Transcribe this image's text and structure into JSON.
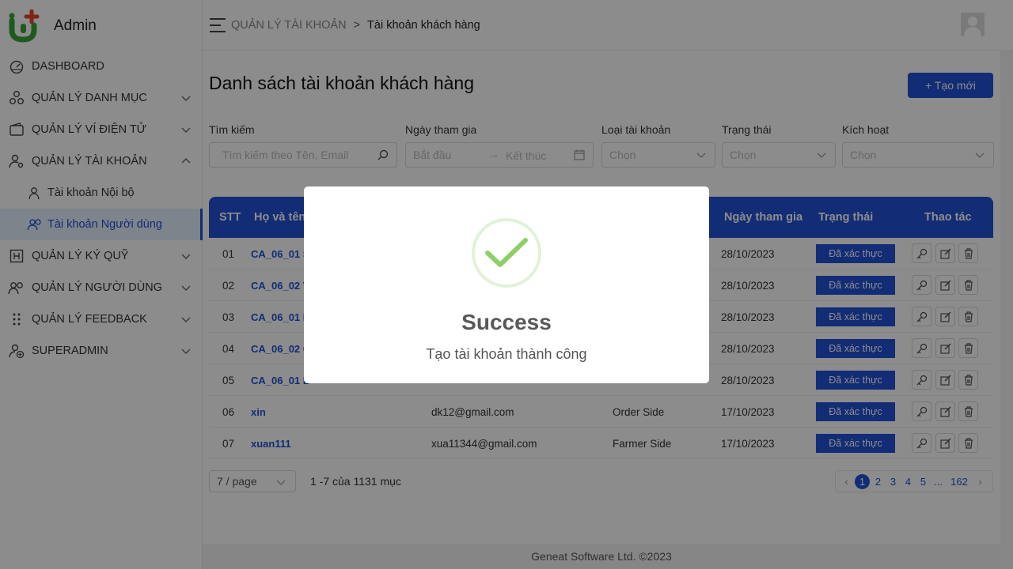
{
  "app": {
    "brand": "Admin"
  },
  "sidebar": {
    "items": [
      {
        "label": "DASHBOARD",
        "icon": "dashboard-icon"
      },
      {
        "label": "QUẢN LÝ DANH MỤC",
        "icon": "category-icon"
      },
      {
        "label": "QUẢN LÝ VÍ ĐIỆN TỬ",
        "icon": "wallet-icon"
      },
      {
        "label": "QUẢN LÝ TÀI KHOẢN",
        "icon": "user-settings-icon"
      },
      {
        "label": "Tài khoản Nội bộ",
        "icon": "user-icon"
      },
      {
        "label": "Tài khoản Người dùng",
        "icon": "users-icon"
      },
      {
        "label": "QUẢN LÝ KÝ QUỸ",
        "icon": "deposit-icon"
      },
      {
        "label": "QUẢN LÝ NGƯỜI DÙNG",
        "icon": "users-icon"
      },
      {
        "label": "QUẢN LÝ FEEDBACK",
        "icon": "drag-dots-icon"
      },
      {
        "label": "SUPERADMIN",
        "icon": "user-add-icon"
      }
    ]
  },
  "header": {
    "breadcrumb_parent": "QUẢN LÝ TÀI KHOẢN",
    "breadcrumb_current": "Tài khoản khách hàng"
  },
  "page": {
    "title": "Danh sách tài khoản khách hàng",
    "create_label": "+ Tạo mới"
  },
  "filters": {
    "search_label": "Tìm kiếm",
    "search_placeholder": "Tìm kiếm theo Tên, Email",
    "date_label": "Ngày tham gia",
    "date_start": "Bắt đầu",
    "date_end": "Kết thúc",
    "type_label": "Loại tài khoản",
    "type_value": "Chọn",
    "status_label": "Trạng thái",
    "status_value": "Chọn",
    "active_label": "Kích hoạt",
    "active_value": "Chọn"
  },
  "table": {
    "columns": {
      "stt": "STT",
      "name": "Họ và tên",
      "joined": "Ngày tham gia",
      "status": "Trạng thái",
      "actions": "Thao tác"
    },
    "rows": [
      {
        "stt": "01",
        "name": "CA_06_01 S",
        "email": "",
        "type": "",
        "joined": "28/10/2023",
        "status": "Đã xác thực"
      },
      {
        "stt": "02",
        "name": "CA_06_02 V",
        "email": "",
        "type": "",
        "joined": "28/10/2023",
        "status": "Đã xác thực"
      },
      {
        "stt": "03",
        "name": "CA_06_01 E",
        "email": "",
        "type": "",
        "joined": "28/10/2023",
        "status": "Đã xác thực"
      },
      {
        "stt": "04",
        "name": "CA_06_02 C",
        "email": "",
        "type": "",
        "joined": "28/10/2023",
        "status": "Đã xác thực"
      },
      {
        "stt": "05",
        "name": "CA_06_01 B",
        "email": "",
        "type": "",
        "joined": "28/10/2023",
        "status": "Đã xác thực"
      },
      {
        "stt": "06",
        "name": "xin",
        "email": "dk12@gmail.com",
        "type": "Order Side",
        "joined": "17/10/2023",
        "status": "Đã xác thực"
      },
      {
        "stt": "07",
        "name": "xuan111",
        "email": "xua11344@gmail.com",
        "type": "Farmer Side",
        "joined": "17/10/2023",
        "status": "Đã xác thực"
      }
    ]
  },
  "pagination": {
    "page_size": "7 / page",
    "range": "1 -7 của 1131 mục",
    "pages": [
      "1",
      "2",
      "3",
      "4",
      "5",
      "...",
      "162"
    ],
    "current": "1"
  },
  "footer": {
    "text": "Geneat Software Ltd. ©2023"
  },
  "modal": {
    "title": "Success",
    "message": "Tạo tài khoản thành công",
    "icon": "check-icon"
  },
  "colors": {
    "primary": "#2151d6",
    "success": "#8fcf6a"
  }
}
